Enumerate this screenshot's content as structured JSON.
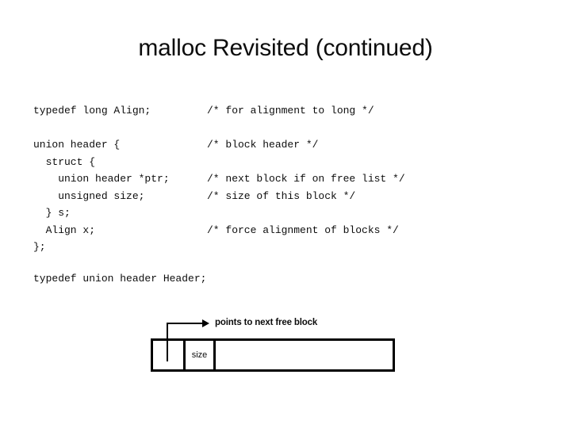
{
  "slide": {
    "title": "malloc Revisited (continued)",
    "background_color": "#ffffff",
    "text_color": "#0d0d0d"
  },
  "code": {
    "lines": [
      {
        "text": "typedef long Align;",
        "comment": "/* for alignment to long */"
      },
      {
        "text": "",
        "comment": ""
      },
      {
        "text": "union header {",
        "comment": "/* block header */"
      },
      {
        "text": "  struct {",
        "comment": ""
      },
      {
        "text": "    union header *ptr;",
        "comment": "/* next block if on free list */"
      },
      {
        "text": "    unsigned size;",
        "comment": "/* size of this block */"
      },
      {
        "text": "  } s;",
        "comment": ""
      },
      {
        "text": "  Align x;",
        "comment": "/* force alignment of blocks */"
      },
      {
        "text": "};",
        "comment": ""
      }
    ],
    "tail": "typedef union header Header;"
  },
  "diagram": {
    "annotation": "points to next free block",
    "cells": [
      {
        "label": ""
      },
      {
        "label": "size"
      },
      {
        "label": ""
      }
    ],
    "border_color": "#000000"
  }
}
